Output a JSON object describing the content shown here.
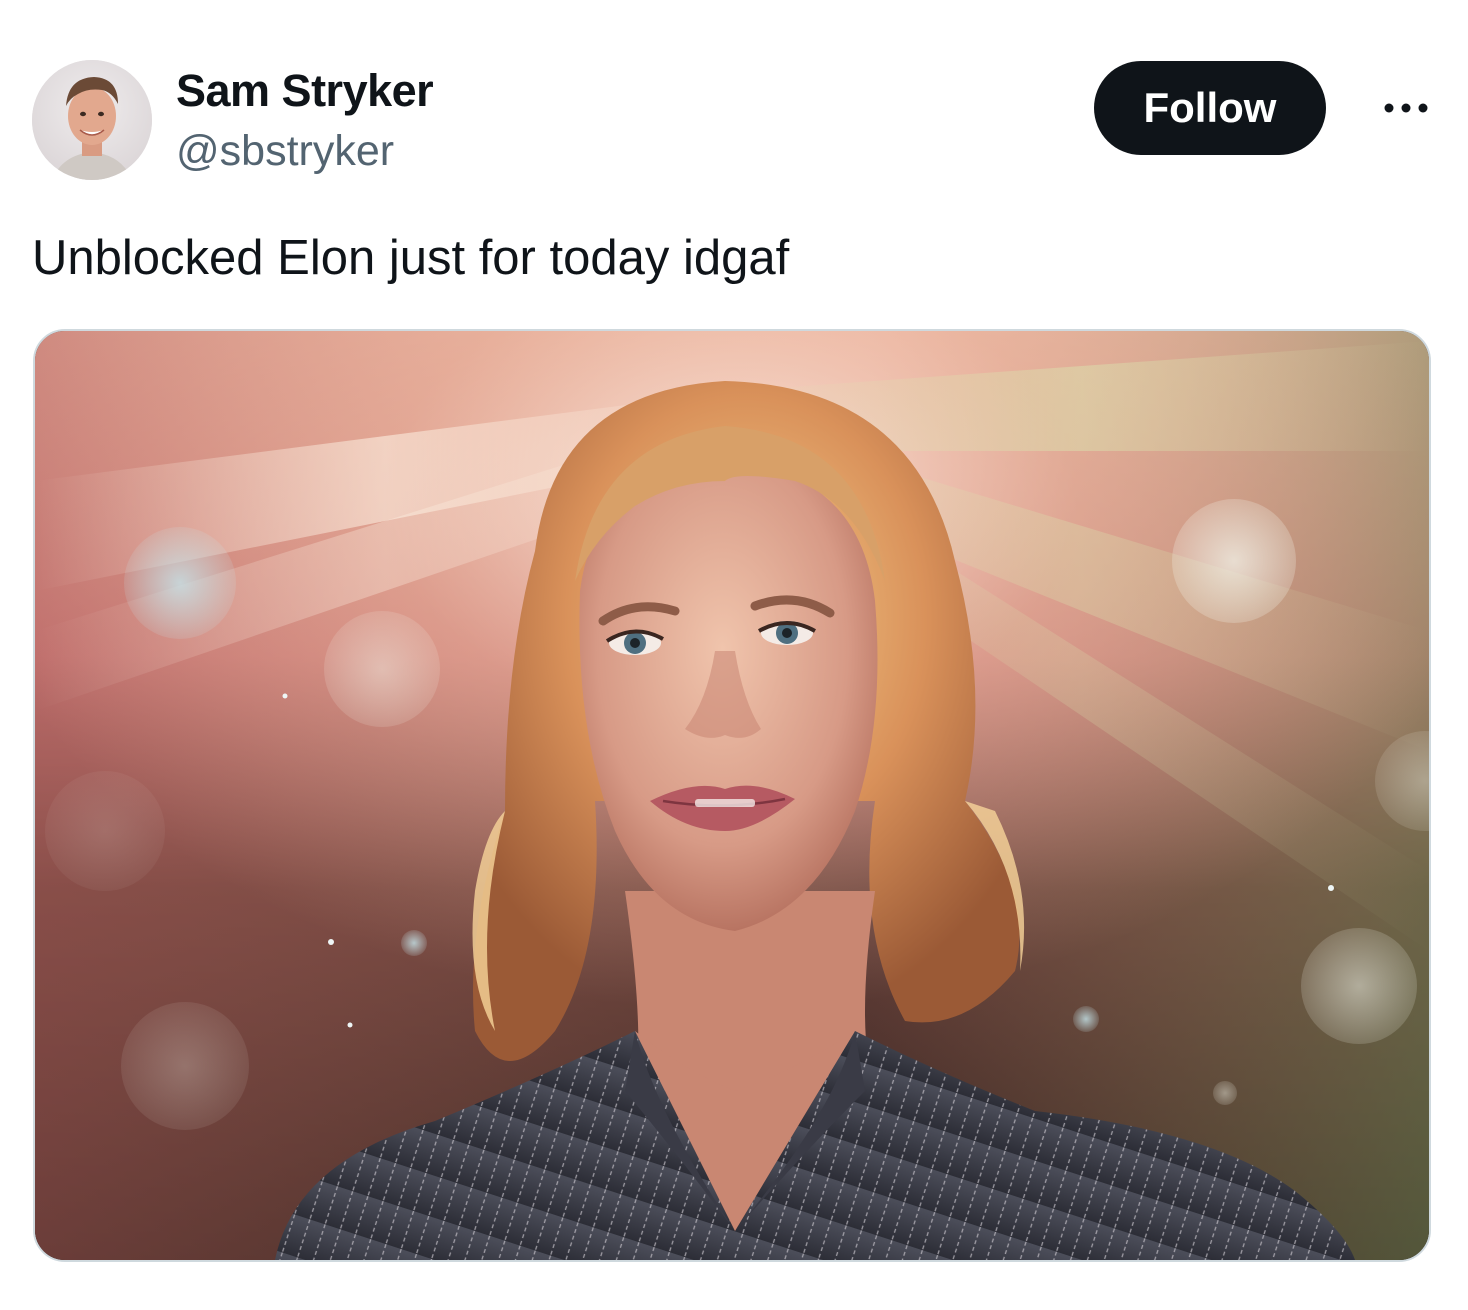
{
  "tweet": {
    "author": {
      "display_name": "Sam Stryker",
      "handle": "@sbstryker",
      "avatar_icon": "avatar-photo"
    },
    "follow_label": "Follow",
    "more_icon": "more-horizontal-icon",
    "text": "Unblocked Elon just for today idgaf",
    "media": {
      "type": "photo"
    }
  },
  "colors": {
    "follow_bg": "#0f1419",
    "handle": "#536471",
    "border": "#cfd9de"
  }
}
